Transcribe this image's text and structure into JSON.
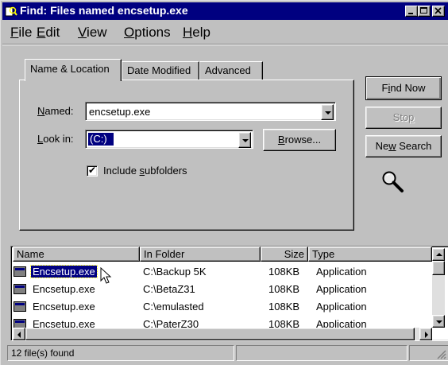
{
  "window": {
    "title": "Find: Files named encsetup.exe"
  },
  "menu": [
    {
      "first": "F",
      "rest": "ile"
    },
    {
      "first": "E",
      "rest": "dit"
    },
    {
      "first": "V",
      "rest": "iew"
    },
    {
      "first": "O",
      "rest": "ptions"
    },
    {
      "first": "H",
      "rest": "elp"
    }
  ],
  "tabs": [
    "Name & Location",
    "Date Modified",
    "Advanced"
  ],
  "form": {
    "named_label_key": "N",
    "named_label_rest": "amed:",
    "named_value": "encsetup.exe",
    "lookin_label_key": "L",
    "lookin_label_rest": "ook in:",
    "lookin_value": "(C:)",
    "browse_key": "B",
    "browse_rest": "rowse...",
    "include_pre": "Include ",
    "include_key": "s",
    "include_rest": "ubfolders",
    "include_checked": "✔"
  },
  "buttons": {
    "find_pre": "F",
    "find_key": "i",
    "find_rest": "nd Now",
    "stop_pre": "Sto",
    "stop_key": "p",
    "new_pre": "Ne",
    "new_key": "w",
    "new_rest": " Search"
  },
  "columns": [
    "Name",
    "In Folder",
    "Size",
    "Type"
  ],
  "rows": [
    {
      "name": "Encsetup.exe",
      "folder": "C:\\Backup 5K",
      "size": "108KB",
      "type": "Application",
      "selected": true
    },
    {
      "name": "Encsetup.exe",
      "folder": "C:\\BetaZ31",
      "size": "108KB",
      "type": "Application"
    },
    {
      "name": "Encsetup.exe",
      "folder": "C:\\emulasted",
      "size": "108KB",
      "type": "Application"
    },
    {
      "name": "Encsetup.exe",
      "folder": "C:\\PaterZ30",
      "size": "108KB",
      "type": "Application"
    }
  ],
  "status": {
    "text": "12 file(s) found"
  },
  "colors": {
    "title_bar": "#000080",
    "face": "#c0c0c0",
    "selection": "#000080"
  },
  "icons": [
    "magnifier-icon",
    "file-icon",
    "mouse-cursor-icon",
    "checkmark-icon"
  ]
}
